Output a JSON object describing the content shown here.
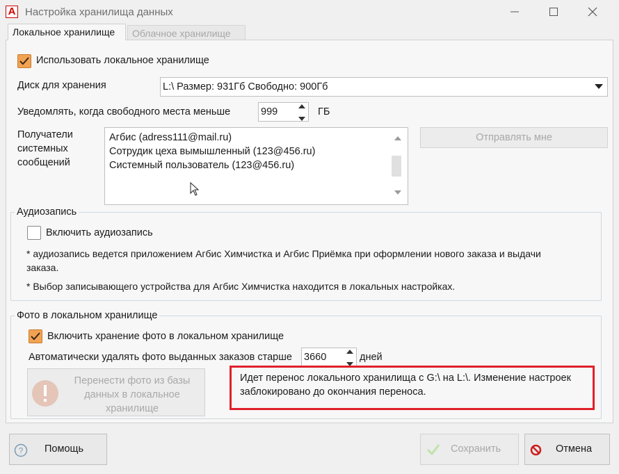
{
  "window": {
    "title": "Настройка хранилища данных",
    "app_icon_letter": "A"
  },
  "tabs": [
    {
      "label": "Локальное хранилище",
      "active": true
    },
    {
      "label": "Облачное хранилище",
      "active": false
    }
  ],
  "local": {
    "use_local_label": "Использовать локальное хранилище",
    "use_local_checked": true,
    "disk_label": "Диск для хранения",
    "disk_value": "L:\\ Размер: 931Гб Свободно: 900Гб",
    "notify_label": "Уведомлять, когда свободного места меньше",
    "notify_value": "999",
    "notify_unit": "ГБ",
    "recipients_label_1": "Получатели",
    "recipients_label_2": "системных",
    "recipients_label_3": "сообщений",
    "recipients": [
      "Агбис (adress111@mail.ru)",
      "Сотрудик цеха вымышленный (123@456.ru)",
      "Системный пользователь (123@456.ru)"
    ],
    "send_me_button": "Отправлять мне"
  },
  "audio": {
    "group_title": "Аудиозапись",
    "enable_label": "Включить аудиозапись",
    "enable_checked": false,
    "note1_line1": "* аудиозапись ведется приложением Агбис Химчистка и Агбис Приёмка при оформлении нового заказа и выдачи",
    "note1_line2": "заказа.",
    "note2": "* Выбор записывающего устройства для Агбис Химчистка находится в локальных настройках."
  },
  "photo": {
    "group_title": "Фото в локальном хранилище",
    "enable_label": "Включить хранение фото в локальном хранилище",
    "enable_checked": true,
    "autodelete_label": "Автоматически удалять фото выданных заказов старше",
    "autodelete_value": "3660",
    "autodelete_unit": "дней",
    "transfer_button_line1": "Перенести фото из базы",
    "transfer_button_line2": "данных в локальное",
    "transfer_button_line3": "хранилище",
    "warning_line1": "Идет перенос локального хранилища с G:\\ на L:\\. Изменение настроек",
    "warning_line2": "заблокировано  до окончания переноса."
  },
  "footer": {
    "help_button": "Помощь",
    "save_button": "Сохранить",
    "cancel_button": "Отмена"
  },
  "colors": {
    "accent_orange": "#f2a253",
    "warning_border": "#e0202c",
    "cancel_red": "#cc1f1f",
    "save_green": "#8ccf6a"
  }
}
